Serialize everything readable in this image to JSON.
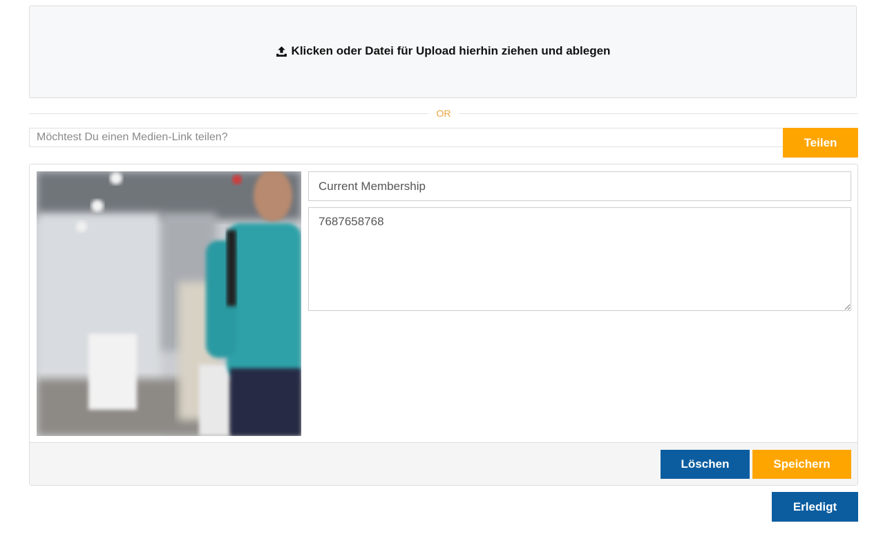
{
  "dropzone": {
    "label": "Klicken oder Datei für Upload hierhin ziehen und ablegen",
    "icon": "upload-icon"
  },
  "divider": {
    "text": "OR",
    "color": "#e8a33a"
  },
  "media_link": {
    "placeholder": "Möchtest Du einen Medien-Link teilen?",
    "value": "",
    "share_label": "Teilen"
  },
  "media_item": {
    "title_value": "Current Membership",
    "description_value": "7687658768",
    "delete_label": "Löschen",
    "save_label": "Speichern"
  },
  "footer": {
    "done_label": "Erledigt"
  },
  "colors": {
    "accent_orange": "#ffa500",
    "primary_blue": "#0b5da0"
  }
}
